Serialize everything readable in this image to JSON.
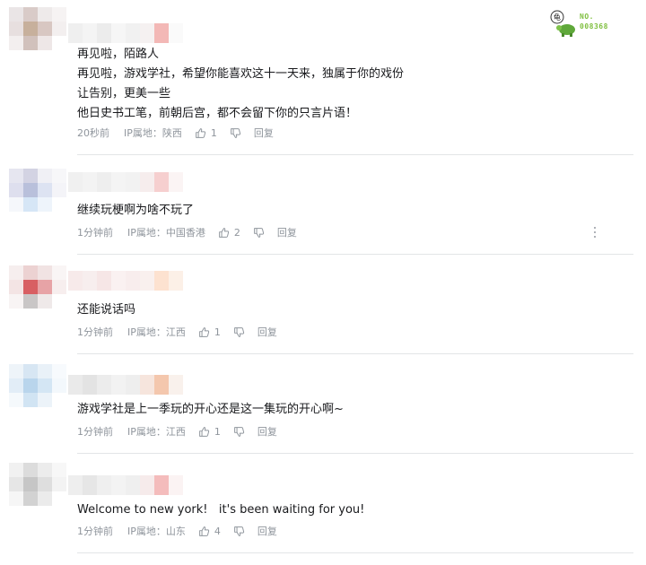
{
  "badge": {
    "glyph": "龟",
    "number_label": "NO.\n008368",
    "color": "#7fbf3f"
  },
  "comments": [
    {
      "text": "再见啦，陌路人\n再见啦，游戏学社，希望你能喜欢这十一天来，独属于你的戏份\n让告别，更美一些\n他日史书工笔，前朝后宫，都不会留下你的只言片语！",
      "time": "20秒前",
      "location": "IP属地：陕西",
      "likes": "1",
      "reply": "回复"
    },
    {
      "text": "继续玩梗啊为啥不玩了",
      "time": "1分钟前",
      "location": "IP属地：中国香港",
      "likes": "2",
      "reply": "回复"
    },
    {
      "text": "还能说话吗",
      "time": "1分钟前",
      "location": "IP属地：江西",
      "likes": "1",
      "reply": "回复"
    },
    {
      "text": "游戏学社是上一季玩的开心还是这一集玩的开心啊~",
      "time": "1分钟前",
      "location": "IP属地：江西",
      "likes": "1",
      "reply": "回复"
    },
    {
      "text": "Welcome to new york!   it's been waiting for you!",
      "time": "1分钟前",
      "location": "IP属地：山东",
      "likes": "4",
      "reply": "回复"
    }
  ]
}
